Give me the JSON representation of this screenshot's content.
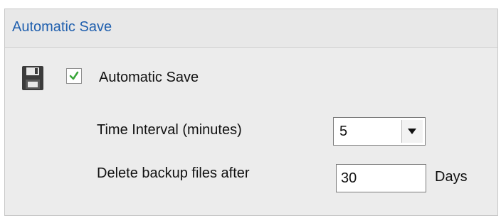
{
  "panel": {
    "title": "Automatic Save"
  },
  "auto_save": {
    "label": "Automatic Save",
    "checked": true,
    "icon": "save-icon",
    "check_color": "#3aa63a"
  },
  "time_interval": {
    "label": "Time Interval (minutes)",
    "selected": "5"
  },
  "delete_backup": {
    "label": "Delete backup files after",
    "value": "30",
    "unit": "Days"
  },
  "colors": {
    "title": "#1f5fae",
    "panel_bg": "#ececec"
  }
}
